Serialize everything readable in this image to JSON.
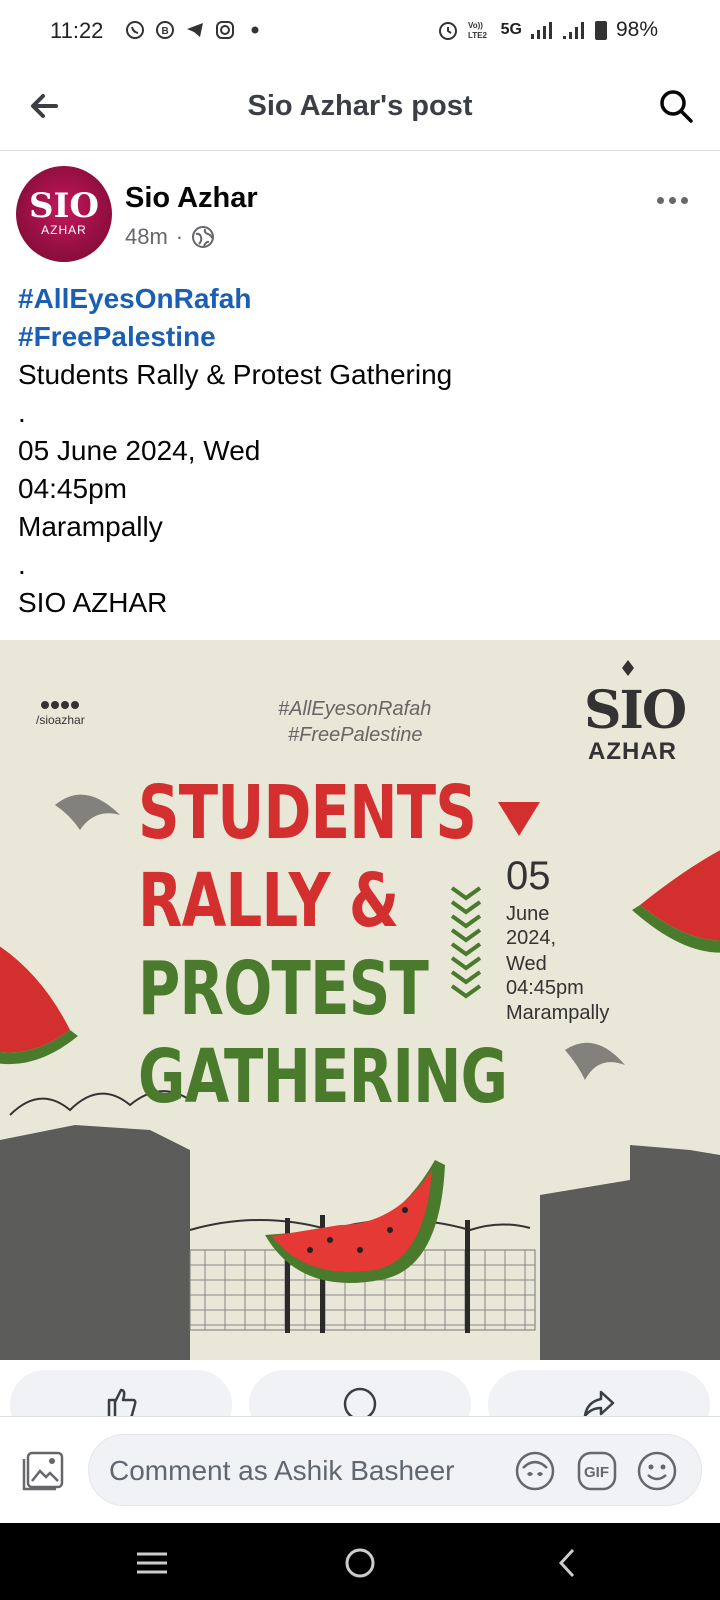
{
  "status_bar": {
    "time": "11:22",
    "network": "5G",
    "battery": "98%",
    "icons": [
      "whatsapp-icon",
      "whatsapp-business-icon",
      "telegram-icon",
      "instagram-icon",
      "dot-icon",
      "alarm-icon",
      "volte-icon",
      "signal-icon",
      "battery-icon"
    ]
  },
  "nav": {
    "title": "Sio Azhar's post",
    "back_icon": "arrow-left-icon",
    "search_icon": "search-icon"
  },
  "post": {
    "author": "Sio Azhar",
    "avatar": {
      "line1": "SIO",
      "line2": "AZHAR"
    },
    "time": "48m",
    "separator": "·",
    "privacy_icon": "globe-icon",
    "text": {
      "hashtag1": "#AllEyesOnRafah",
      "hashtag2": "#FreePalestine",
      "line3": "Students Rally & Protest Gathering",
      "line4": ".",
      "line5": "05 June 2024, Wed",
      "line6": "04:45pm",
      "line7": "Marampally",
      "line8": ".",
      "line9": "SIO AZHAR"
    }
  },
  "poster": {
    "social_handle": "/sioazhar",
    "hashtag1": "#AllEyesonRafah",
    "hashtag2": "#FreePalestine",
    "logo_sio": "SIO",
    "logo_azhar": "AZHAR",
    "headline1": "STUDENTS",
    "headline2": "RALLY &",
    "headline3": "PROTEST",
    "headline4": "GATHERING",
    "date_day": "05",
    "date_line1": "June",
    "date_line2": "2024,",
    "date_line3": "Wed",
    "date_line4": "04:45pm",
    "date_line5": "Marampally",
    "colors": {
      "red": "#d32f2f",
      "green": "#4a7a2c",
      "background": "#e8e6d6"
    }
  },
  "actions": [
    "like-icon",
    "comment-icon",
    "share-icon"
  ],
  "comment_bar": {
    "placeholder": "Comment as Ashik Basheer",
    "icons": [
      "photo-icon",
      "avatar-sticker-icon",
      "gif-icon",
      "emoji-icon"
    ]
  },
  "system_nav": [
    "recents-icon",
    "home-icon",
    "back-icon"
  ]
}
